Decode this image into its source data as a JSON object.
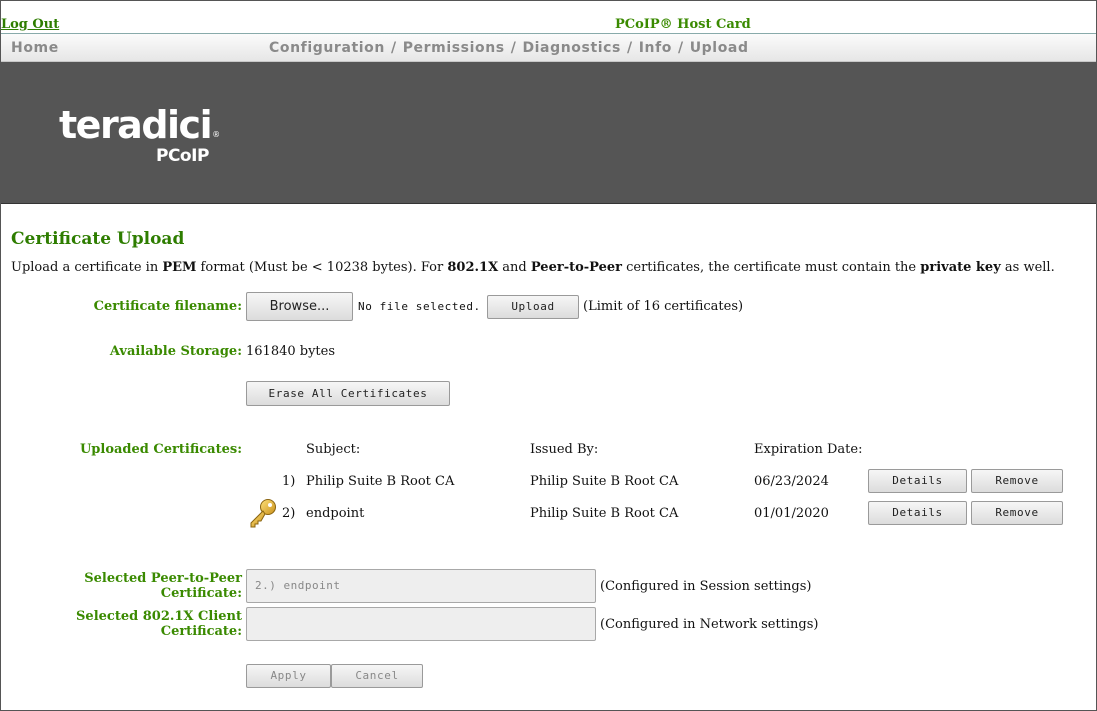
{
  "header": {
    "logout": "Log Out",
    "device": "PCoIP® Host Card"
  },
  "nav": {
    "home": "Home",
    "items": [
      "Configuration",
      "Permissions",
      "Diagnostics",
      "Info",
      "Upload"
    ]
  },
  "banner": {
    "logo_text": "teradici",
    "logo_reg": "®",
    "logo_sub": "PCoIP"
  },
  "page": {
    "title": "Certificate Upload",
    "intro": {
      "t1": "Upload a certificate in ",
      "b1": "PEM",
      "t2": " format (Must be < 10238 bytes). For ",
      "b2": "802.1X",
      "t3": " and ",
      "b3": "Peer-to-Peer",
      "t4": " certificates, the certificate must contain the ",
      "b4": "private key",
      "t5": " as well."
    }
  },
  "upload": {
    "label": "Certificate filename:",
    "browse": "Browse...",
    "no_file": "No file selected.",
    "upload_btn": "Upload",
    "limit": "(Limit of 16 certificates)"
  },
  "storage": {
    "label": "Available Storage:",
    "value": "161840 bytes"
  },
  "erase_btn": "Erase All Certificates",
  "certs": {
    "label": "Uploaded Certificates:",
    "headers": {
      "subject": "Subject:",
      "issued_by": "Issued By:",
      "expiration": "Expiration Date:"
    },
    "rows": [
      {
        "num": "1)",
        "subject": "Philip Suite B Root CA",
        "issuer": "Philip Suite B Root CA",
        "expires": "06/23/2024",
        "details": "Details",
        "remove": "Remove",
        "icon": "none"
      },
      {
        "num": "2)",
        "subject": "endpoint",
        "issuer": "Philip Suite B Root CA",
        "expires": "01/01/2020",
        "details": "Details",
        "remove": "Remove",
        "icon": "key-icon"
      }
    ]
  },
  "selected": {
    "p2p_label": "Selected Peer-to-Peer Certificate:",
    "p2p_value": "2.) endpoint",
    "p2p_note": "(Configured in Session settings)",
    "dot1x_label": "Selected 802.1X Client Certificate:",
    "dot1x_value": "",
    "dot1x_note": "(Configured in Network settings)"
  },
  "actions": {
    "apply": "Apply",
    "cancel": "Cancel"
  },
  "colors": {
    "accent_green": "#3a8a00",
    "banner_gray": "#555555",
    "nav_text": "#8a8a8a"
  }
}
